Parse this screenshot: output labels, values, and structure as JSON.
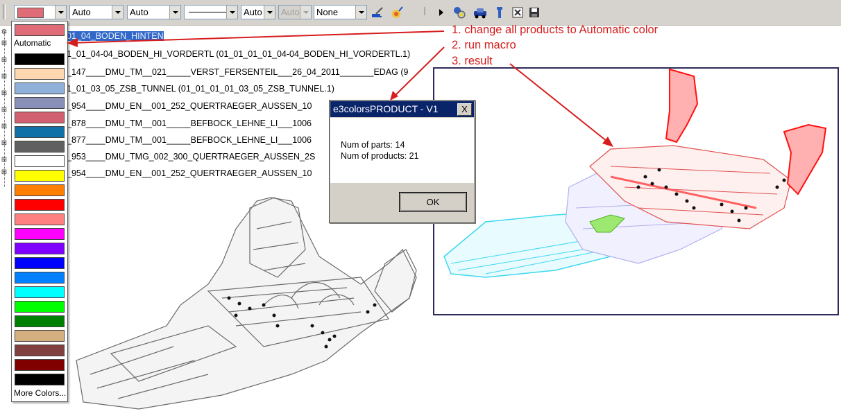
{
  "toolbar": {
    "fill_color_combo": "",
    "transparency_combo": "Auto",
    "thickness_combo": "Auto",
    "linetype_combo": "",
    "point_combo": "Auto",
    "layer_combo": "Auto",
    "render_combo": "None",
    "icons": [
      "paint-brush-icon",
      "painter-icon",
      "play-arrow-icon",
      "search-parts-icon",
      "car-icon",
      "tool-icon",
      "close-doc-icon",
      "save-icon"
    ]
  },
  "tree": {
    "rows": [
      "01_04_BODEN_HINTEN",
      "1_01_04-04_BODEN_HI_VORDERTL (01_01_01_01_04-04_BODEN_HI_VORDERTL.1)",
      "_147____DMU_TM__021_____VERST_FERSENTEIL___26_04_2011_______EDAG (9",
      "1_01_03_05_ZSB_TUNNEL (01_01_01_01_03_05_ZSB_TUNNEL.1)",
      "_954____DMU_EN__001_252_QUERTRAEGER_AUSSEN_10",
      "_878____DMU_TM__001_____BEFBOCK_LEHNE_LI___1006",
      "_877____DMU_TM__001_____BEFBOCK_LEHNE_LI___1006",
      "_953____DMU_TMG_002_300_QUERTRAEGER_AUSSEN_2S",
      "_954____DMU_EN__001_252_QUERTRAEGER_AUSSEN_10"
    ]
  },
  "palette": {
    "automatic_label": "Automatic",
    "more_label": "More Colors...",
    "top_color": "#e06c78",
    "colors": [
      "#000000",
      "#ffd7b0",
      "#8fb0d8",
      "#8890b8",
      "#d06070",
      "#1070a8",
      "#606060",
      "#ffffff",
      "#ffff00",
      "#ff8000",
      "#ff0000",
      "#ff8080",
      "#ff00ff",
      "#8000ff",
      "#0000ff",
      "#0080ff",
      "#00ffff",
      "#00ff00",
      "#008000",
      "#d4b080",
      "#804040",
      "#800000",
      "#000000"
    ]
  },
  "dialog": {
    "title": "e3colorsPRODUCT - V1",
    "close_label": "X",
    "parts_line": "Num of parts: 14",
    "products_line": "Num of products: 21",
    "ok_label": "OK"
  },
  "annotations": {
    "step1": "1. change all products to Automatic color",
    "step2": "2. run macro",
    "step3": "3. result",
    "color": "#d61c1c"
  }
}
